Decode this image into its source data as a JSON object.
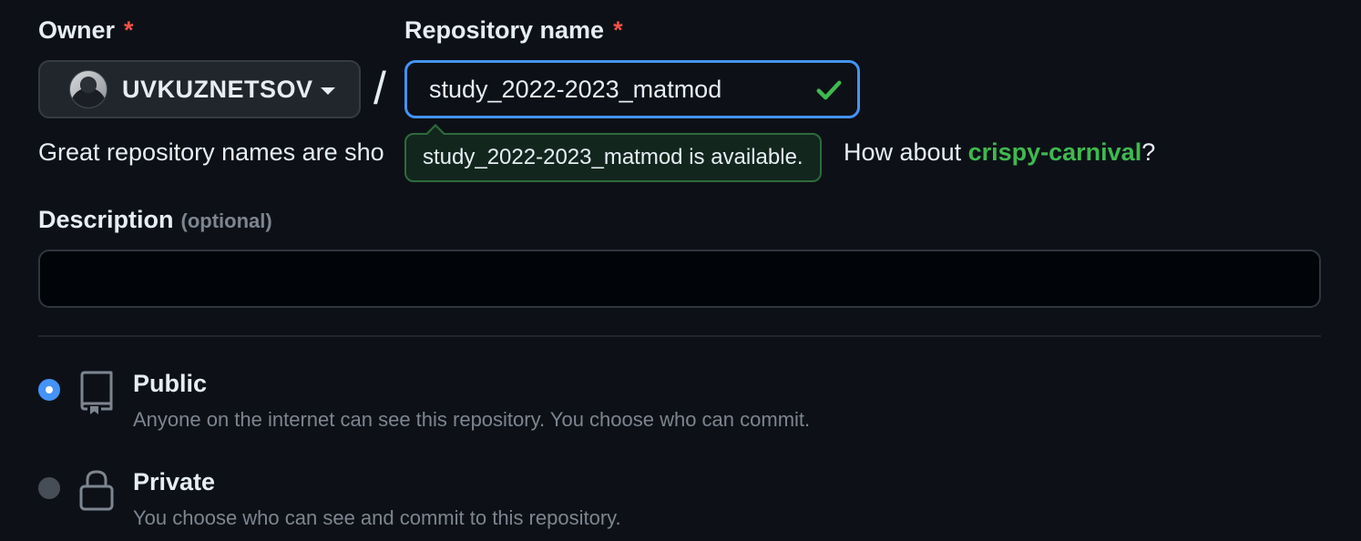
{
  "owner": {
    "label": "Owner",
    "required_mark": "*",
    "value": "UVKUZNETSOV"
  },
  "separator": "/",
  "repo_name": {
    "label": "Repository name",
    "required_mark": "*",
    "value": "study_2022-2023_matmod",
    "availability_tooltip": "study_2022-2023_matmod is available."
  },
  "hint": {
    "prefix": "Great repository names are sho",
    "how_about": "How about ",
    "suggestion": "crispy-carnival",
    "suffix": "?"
  },
  "description": {
    "label": "Description",
    "optional": "(optional)",
    "value": ""
  },
  "visibility": {
    "public": {
      "title": "Public",
      "description": "Anyone on the internet can see this repository. You choose who can commit.",
      "selected": true
    },
    "private": {
      "title": "Private",
      "description": "You choose who can see and commit to this repository.",
      "selected": false
    }
  },
  "colors": {
    "background": "#0d1117",
    "accent_blue": "#4493f8",
    "success_green": "#3fb950",
    "required_red": "#f85149",
    "muted_text": "#7d8590"
  },
  "icons": {
    "owner_avatar": "avatar",
    "owner_dropdown": "caret-down-icon",
    "name_valid": "check-icon",
    "public": "repo-icon",
    "private": "lock-icon"
  }
}
